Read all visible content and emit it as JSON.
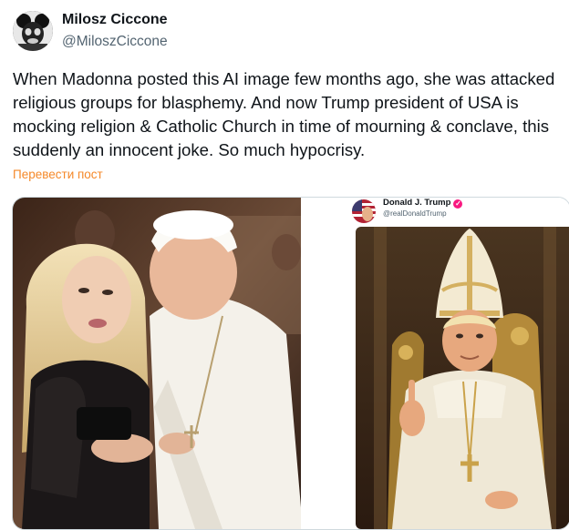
{
  "author": {
    "name": "Milosz Ciccone",
    "handle": "@MiloszCiccone",
    "avatar_icon": "mickey-skull-avatar-icon"
  },
  "post": {
    "lines": [
      "When Madonna posted this AI image few months ago, she was attacked",
      "religious groups for blasphemy. And now Trump president of USA is",
      "mocking religion & Catholic Church in time of mourning & conclave, this",
      "suddenly an innocent joke. So much hypocrisy."
    ],
    "translate_label": "Перевести пост"
  },
  "media": {
    "left_image_icon": "madonna-with-pope-photo",
    "right_image": {
      "embedded_name": "Donald J. Trump",
      "embedded_handle": "@realDonaldTrump",
      "image_icon": "trump-as-pope-photo"
    }
  },
  "colors": {
    "text": "#0f1419",
    "secondary": "#536471",
    "translate": "#f5892a",
    "verified": "#f91880"
  }
}
